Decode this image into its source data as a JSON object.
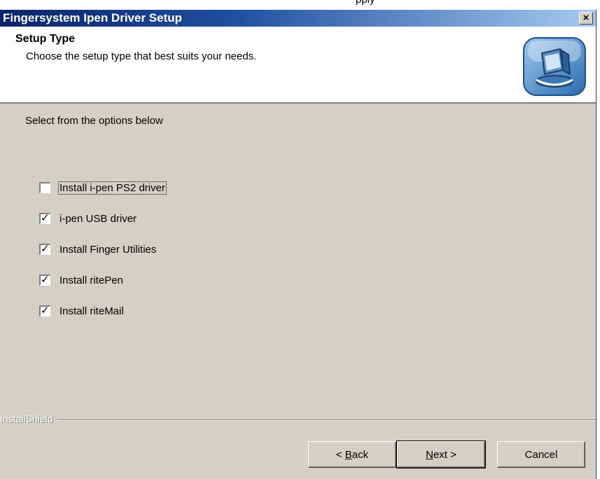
{
  "top_strip_text": "pply",
  "window": {
    "title": "Fingersystem Ipen Driver Setup",
    "close_glyph": "×"
  },
  "header": {
    "title": "Setup Type",
    "subtitle": "Choose the setup type that best suits your needs.",
    "logo_icon": "installer-computer-icon"
  },
  "content": {
    "prompt": "Select from the options below",
    "options": [
      {
        "label": "Install i-pen PS2 driver",
        "checked": false
      },
      {
        "label": "i-pen USB driver",
        "checked": true
      },
      {
        "label": "Install Finger Utilities",
        "checked": true
      },
      {
        "label": "Install ritePen",
        "checked": true
      },
      {
        "label": "Install riteMail",
        "checked": true
      }
    ]
  },
  "footer": {
    "brand": "InstallShield",
    "back_prefix": "< ",
    "back_accel": "B",
    "back_rest": "ack",
    "next_accel": "N",
    "next_rest": "ext >",
    "cancel": "Cancel"
  }
}
